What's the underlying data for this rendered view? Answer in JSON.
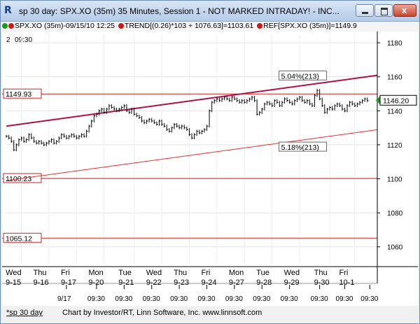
{
  "window": {
    "title": "sp 30 day: SPX.XO (35m) 35 Minutes, Session 1 - NOT MARKED INTRADAY! - INC...",
    "minimize": "minimize",
    "maximize": "maximize",
    "close": "x"
  },
  "legend": {
    "symbol": "SPX.XO (35m)-09/15/10 12:25",
    "trend": "TREND[(0.26)*103 + 1076.63]=1103.61",
    "ref": "REF[SPX.XO (35m)]=1149.9",
    "colors": {
      "green": "#1a9a1a",
      "red": "#cc1a1a"
    }
  },
  "chart_data": {
    "type": "line",
    "title": "",
    "xlabel": "",
    "ylabel": "",
    "header_left": "2",
    "header_time": "09:30",
    "ylim": [
      1050,
      1185
    ],
    "y_ticks": [
      "1180",
      "1160",
      "1140",
      "1120",
      "1100",
      "1080",
      "1060"
    ],
    "last_price_label": "1146.20",
    "ref_lines": [
      {
        "label": "1149.93",
        "value": 1149.93
      },
      {
        "label": "1100.23",
        "value": 1100.23
      },
      {
        "label": "1065.12",
        "value": 1065.12
      }
    ],
    "channel_labels": [
      "5.04%(213)",
      "5.18%(213)"
    ],
    "upper_channel": [
      [
        0,
        1131
      ],
      [
        213,
        1174
      ]
    ],
    "lower_channel": [
      [
        0,
        1099
      ],
      [
        213,
        1142
      ]
    ],
    "x_days": [
      {
        "day": "Wed",
        "date": "9-15",
        "idx": 2
      },
      {
        "day": "Thu",
        "date": "9-16",
        "idx": 13
      },
      {
        "day": "Fri",
        "date": "9-17",
        "idx": 24
      },
      {
        "day": "Mon",
        "date": "9-20",
        "idx": 35
      },
      {
        "day": "Tue",
        "date": "9-21",
        "idx": 47
      },
      {
        "day": "Wed",
        "date": "9-22",
        "idx": 58
      },
      {
        "day": "Thu",
        "date": "9-23",
        "idx": 69
      },
      {
        "day": "Fri",
        "date": "9-24",
        "idx": 80
      },
      {
        "day": "Mon",
        "date": "9-27",
        "idx": 91
      },
      {
        "day": "Tue",
        "date": "9-28",
        "idx": 102
      },
      {
        "day": "Wed",
        "date": "9-29",
        "idx": 113
      },
      {
        "day": "Thu",
        "date": "9-30",
        "idx": 125
      },
      {
        "day": "Fri",
        "date": "10-1",
        "idx": 135
      }
    ],
    "x_time_labels": [
      {
        "label": "9/17",
        "idx": 24
      },
      {
        "label": "09:30",
        "idx": 36
      },
      {
        "label": "09:30",
        "idx": 47
      },
      {
        "label": "09:30",
        "idx": 58
      },
      {
        "label": "09:30",
        "idx": 69
      },
      {
        "label": "09:30",
        "idx": 80
      },
      {
        "label": "09:30",
        "idx": 91
      },
      {
        "label": "09:30",
        "idx": 102
      },
      {
        "label": "09:30",
        "idx": 113
      },
      {
        "label": "09:30",
        "idx": 125
      },
      {
        "label": "09:30",
        "idx": 135
      },
      {
        "label": "09:30",
        "idx": 145
      }
    ],
    "x_range": [
      0,
      148
    ],
    "series": [
      {
        "close": [
          [
            0,
            1125
          ],
          [
            1,
            1124
          ],
          [
            2,
            1122
          ],
          [
            3,
            1117
          ],
          [
            4,
            1120
          ],
          [
            5,
            1123
          ],
          [
            6,
            1124
          ],
          [
            7,
            1122
          ],
          [
            8,
            1123
          ],
          [
            9,
            1126
          ],
          [
            10,
            1124
          ],
          [
            11,
            1122
          ],
          [
            12,
            1121
          ],
          [
            13,
            1122
          ],
          [
            14,
            1121
          ],
          [
            15,
            1120
          ],
          [
            16,
            1121
          ],
          [
            17,
            1122
          ],
          [
            18,
            1123
          ],
          [
            19,
            1121
          ],
          [
            20,
            1122
          ],
          [
            21,
            1124
          ],
          [
            22,
            1126
          ],
          [
            23,
            1125
          ],
          [
            24,
            1124
          ],
          [
            25,
            1125
          ],
          [
            26,
            1126
          ],
          [
            27,
            1125
          ],
          [
            28,
            1124
          ],
          [
            29,
            1125
          ],
          [
            30,
            1126
          ],
          [
            31,
            1125
          ],
          [
            32,
            1128
          ],
          [
            33,
            1131
          ],
          [
            34,
            1134
          ],
          [
            35,
            1137
          ],
          [
            36,
            1138
          ],
          [
            37,
            1140
          ],
          [
            38,
            1141
          ],
          [
            39,
            1139
          ],
          [
            40,
            1141
          ],
          [
            41,
            1143
          ],
          [
            42,
            1142
          ],
          [
            43,
            1141
          ],
          [
            44,
            1140
          ],
          [
            45,
            1141
          ],
          [
            46,
            1142
          ],
          [
            47,
            1143
          ],
          [
            48,
            1140
          ],
          [
            49,
            1139
          ],
          [
            50,
            1141
          ],
          [
            51,
            1138
          ],
          [
            52,
            1137
          ],
          [
            53,
            1136
          ],
          [
            54,
            1134
          ],
          [
            55,
            1133
          ],
          [
            56,
            1134
          ],
          [
            57,
            1135
          ],
          [
            58,
            1134
          ],
          [
            59,
            1133
          ],
          [
            60,
            1132
          ],
          [
            61,
            1134
          ],
          [
            62,
            1132
          ],
          [
            63,
            1131
          ],
          [
            64,
            1129
          ],
          [
            65,
            1128
          ],
          [
            66,
            1130
          ],
          [
            67,
            1132
          ],
          [
            68,
            1131
          ],
          [
            69,
            1130
          ],
          [
            70,
            1131
          ],
          [
            71,
            1130
          ],
          [
            72,
            1129
          ],
          [
            73,
            1126
          ],
          [
            74,
            1124
          ],
          [
            75,
            1126
          ],
          [
            76,
            1128
          ],
          [
            77,
            1127
          ],
          [
            78,
            1128
          ],
          [
            79,
            1129
          ],
          [
            80,
            1131
          ],
          [
            81,
            1140
          ],
          [
            82,
            1145
          ],
          [
            83,
            1146
          ],
          [
            84,
            1147
          ],
          [
            85,
            1146
          ],
          [
            86,
            1147
          ],
          [
            87,
            1148
          ],
          [
            88,
            1147
          ],
          [
            89,
            1146
          ],
          [
            90,
            1148
          ],
          [
            91,
            1147
          ],
          [
            92,
            1146
          ],
          [
            93,
            1145
          ],
          [
            94,
            1146
          ],
          [
            95,
            1145
          ],
          [
            96,
            1146
          ],
          [
            97,
            1147
          ],
          [
            98,
            1148
          ],
          [
            99,
            1146
          ],
          [
            100,
            1138
          ],
          [
            101,
            1139
          ],
          [
            102,
            1141
          ],
          [
            103,
            1144
          ],
          [
            104,
            1145
          ],
          [
            105,
            1144
          ],
          [
            106,
            1143
          ],
          [
            107,
            1146
          ],
          [
            108,
            1145
          ],
          [
            109,
            1143
          ],
          [
            110,
            1145
          ],
          [
            111,
            1147
          ],
          [
            112,
            1146
          ],
          [
            113,
            1145
          ],
          [
            114,
            1144
          ],
          [
            115,
            1146
          ],
          [
            116,
            1147
          ],
          [
            117,
            1148
          ],
          [
            118,
            1146
          ],
          [
            119,
            1145
          ],
          [
            120,
            1146
          ],
          [
            121,
            1144
          ],
          [
            122,
            1143
          ],
          [
            123,
            1149
          ],
          [
            124,
            1152
          ],
          [
            125,
            1147
          ],
          [
            126,
            1143
          ],
          [
            127,
            1139
          ],
          [
            128,
            1141
          ],
          [
            129,
            1142
          ],
          [
            130,
            1141
          ],
          [
            131,
            1143
          ],
          [
            132,
            1144
          ],
          [
            133,
            1143
          ],
          [
            134,
            1141
          ],
          [
            135,
            1140
          ],
          [
            136,
            1143
          ],
          [
            137,
            1145
          ],
          [
            138,
            1144
          ],
          [
            139,
            1143
          ],
          [
            140,
            1144
          ],
          [
            141,
            1145
          ],
          [
            142,
            1146
          ],
          [
            143,
            1147
          ],
          [
            144,
            1146
          ]
        ]
      }
    ]
  },
  "footer": {
    "tab": "*sp 30 day",
    "credit": "Chart by Investor/RT, Linn Software, Inc. www.linnsoft.com"
  }
}
